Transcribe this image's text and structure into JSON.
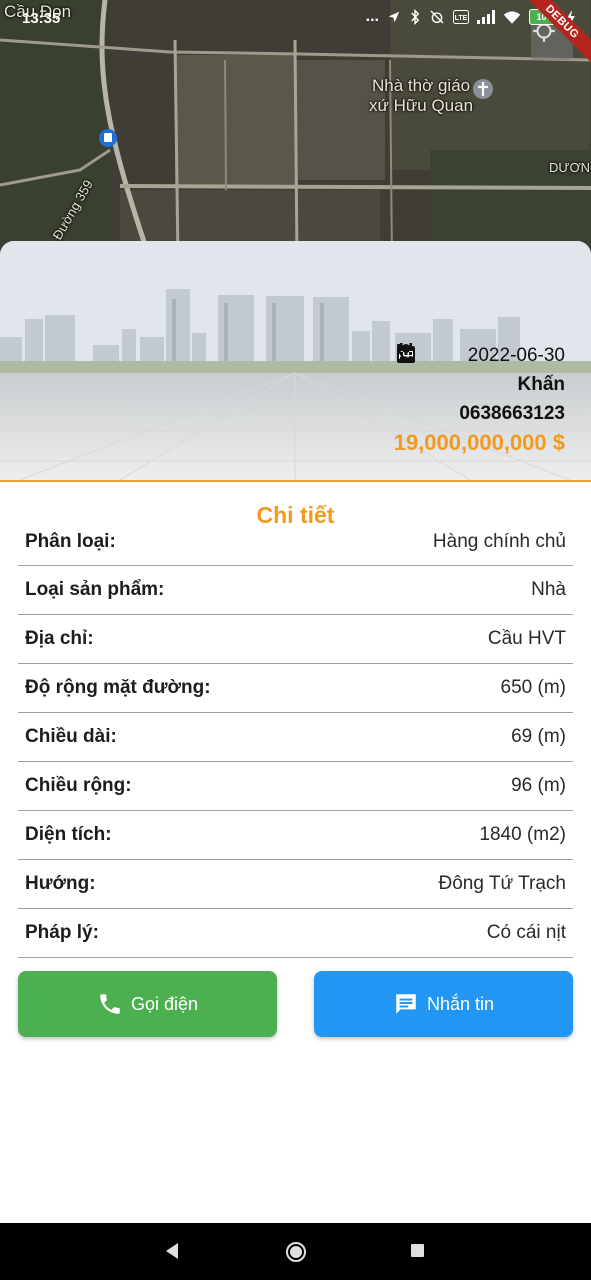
{
  "status_bar": {
    "time": "13:35",
    "dots": "...",
    "battery": "100",
    "icons": [
      "location-arrow-icon",
      "bluetooth-icon",
      "alarm-off-icon",
      "volte-icon",
      "signal-icon",
      "wifi-icon",
      "battery-icon",
      "charging-icon"
    ]
  },
  "debug_banner": "DEBUG",
  "map": {
    "labels": {
      "church_line1": "Nhà thờ giáo",
      "church_line2": "xứ Hữu Quan",
      "top_left": "Cầu Đọn",
      "road_right": "DƯƠNG",
      "road_left": "Đường 359"
    }
  },
  "listing": {
    "date": "2022-06-30",
    "owner": "Khấn",
    "phone": "0638663123",
    "price": "19,000,000,000 $"
  },
  "details": {
    "title": "Chi tiết",
    "rows": [
      {
        "label": "Phân loại:",
        "value": "Hàng chính chủ"
      },
      {
        "label": "Loại sản phẩm:",
        "value": "Nhà"
      },
      {
        "label": "Địa chỉ:",
        "value": "Cầu HVT"
      },
      {
        "label": "Độ rộng mặt đường:",
        "value": "650 (m)"
      },
      {
        "label": "Chiều dài:",
        "value": "69 (m)"
      },
      {
        "label": "Chiều rộng:",
        "value": "96 (m)"
      },
      {
        "label": "Diện tích:",
        "value": "1840 (m2)"
      },
      {
        "label": "Hướng:",
        "value": "Đông Tứ Trạch"
      },
      {
        "label": "Pháp lý:",
        "value": "Có cái nịt"
      }
    ]
  },
  "actions": {
    "call_label": "Gọi điện",
    "message_label": "Nhắn tin"
  },
  "colors": {
    "accent_orange": "#f29a1f",
    "call_green": "#4caf50",
    "message_blue": "#2196f3"
  }
}
